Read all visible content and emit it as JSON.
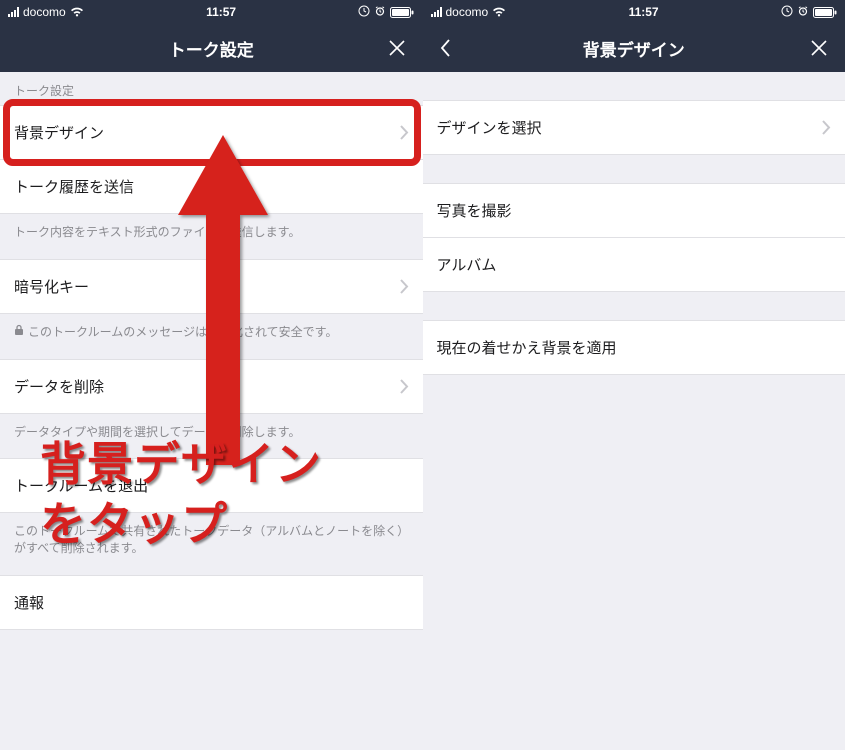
{
  "status": {
    "carrier": "docomo",
    "time": "11:57"
  },
  "left": {
    "title": "トーク設定",
    "section1": "トーク設定",
    "items": {
      "background": "背景デザイン",
      "send_history": "トーク履歴を送信",
      "send_history_footer": "トーク内容をテキスト形式のファイルで送信します。",
      "encryption": "暗号化キー",
      "encryption_footer": "このトークルームのメッセージは暗号化されて安全です。",
      "delete_data": "データを削除",
      "delete_data_footer": "データタイプや期間を選択してデータを削除します。",
      "leave": "トークルームを退出",
      "leave_footer": "このトークルームで共有されたトークデータ（アルバムとノートを除く）がすべて削除されます。",
      "report": "通報"
    }
  },
  "right": {
    "title": "背景デザイン",
    "items": {
      "select": "デザインを選択",
      "camera": "写真を撮影",
      "album": "アルバム",
      "apply": "現在の着せかえ背景を適用"
    }
  },
  "annotation": {
    "line1": "背景デザイン",
    "line2": "をタップ"
  }
}
